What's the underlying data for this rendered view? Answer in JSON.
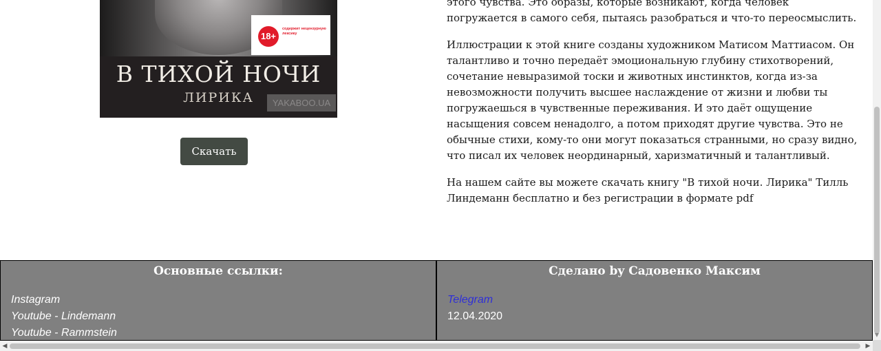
{
  "book": {
    "cover": {
      "title": "В ТИХОЙ НОЧИ",
      "subtitle": "ЛИРИКА",
      "age_rating": "18+",
      "age_note": "содержит нецензурную лексику",
      "watermark": "YAKABOO.UA"
    },
    "download_label": "Скачать"
  },
  "description": {
    "paragraphs": [
      "этого чувства. Это образы, которые возникают, когда человек погружается в самого себя, пытаясь разобраться и что-то переосмыслить.",
      "Иллюстрации к этой книге созданы художником Матисом Маттиасом. Он талантливо и точно передаёт эмоциональную глубину стихотворений, сочетание невыразимой тоски и животных инстинктов, когда из-за невозможности получить высшее наслаждение от жизни и любви ты погружаешься в чувственные переживания. И это даёт ощущение насыщения совсем ненадолго, а потом приходят другие чувства. Это не обычные стихи, кому-то они могут показаться странными, но сразу видно, что писал их человек неординарный, харизматичный и талантливый.",
      "На нашем сайте вы можете скачать книгу \"В тихой ночи. Лирика\" Тилль Линдеманн бесплатно и без регистрации в формате pdf"
    ]
  },
  "footer": {
    "left": {
      "heading": "Основные ссылки:",
      "links": [
        "Instagram",
        "Youtube - Lindemann",
        "Youtube - Rammstein"
      ]
    },
    "right": {
      "heading": "Сделано by Садовенко Максим",
      "link": "Telegram",
      "date": "12.04.2020"
    }
  },
  "colors": {
    "button_bg": "#434a43",
    "footer_bg": "#808080",
    "link_blue": "#2f2fd6",
    "badge_red": "#e11b2a"
  }
}
